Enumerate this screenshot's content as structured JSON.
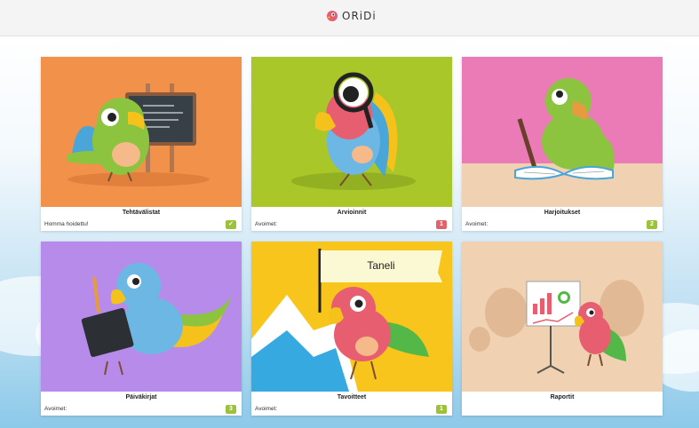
{
  "app": {
    "logo_text": "ORiDi"
  },
  "colors": {
    "orange": "#f2924a",
    "lime": "#a9c729",
    "pink": "#ea7bb7",
    "purple": "#b78bea",
    "yellow": "#f8c51c",
    "peach": "#f0d2b3",
    "badge_red": "#e0626a",
    "badge_green": "#9cc23a"
  },
  "tiles": [
    {
      "title": "Tehtävälistat",
      "status": "Homma hoidettu!",
      "badge": "✓",
      "badge_color": "green",
      "icon": "parrot-chalkboard"
    },
    {
      "title": "Arvioinnit",
      "status": "Avoimet:",
      "badge": "1",
      "badge_color": "red",
      "icon": "parrot-magnifier"
    },
    {
      "title": "Harjoitukset",
      "status": "Avoimet:",
      "badge": "2",
      "badge_color": "green",
      "icon": "parrot-reading"
    },
    {
      "title": "Päiväkirjat",
      "status": "Avoimet:",
      "badge": "3",
      "badge_color": "green",
      "icon": "parrot-notebook"
    },
    {
      "title": "Tavoitteet",
      "status": "Avoimet:",
      "badge": "1",
      "badge_color": "green",
      "icon": "parrot-mountain-flag",
      "flag_text": "Taneli"
    },
    {
      "title": "Raportit",
      "status": "",
      "badge": "",
      "badge_color": "",
      "icon": "parrot-presentation"
    }
  ]
}
